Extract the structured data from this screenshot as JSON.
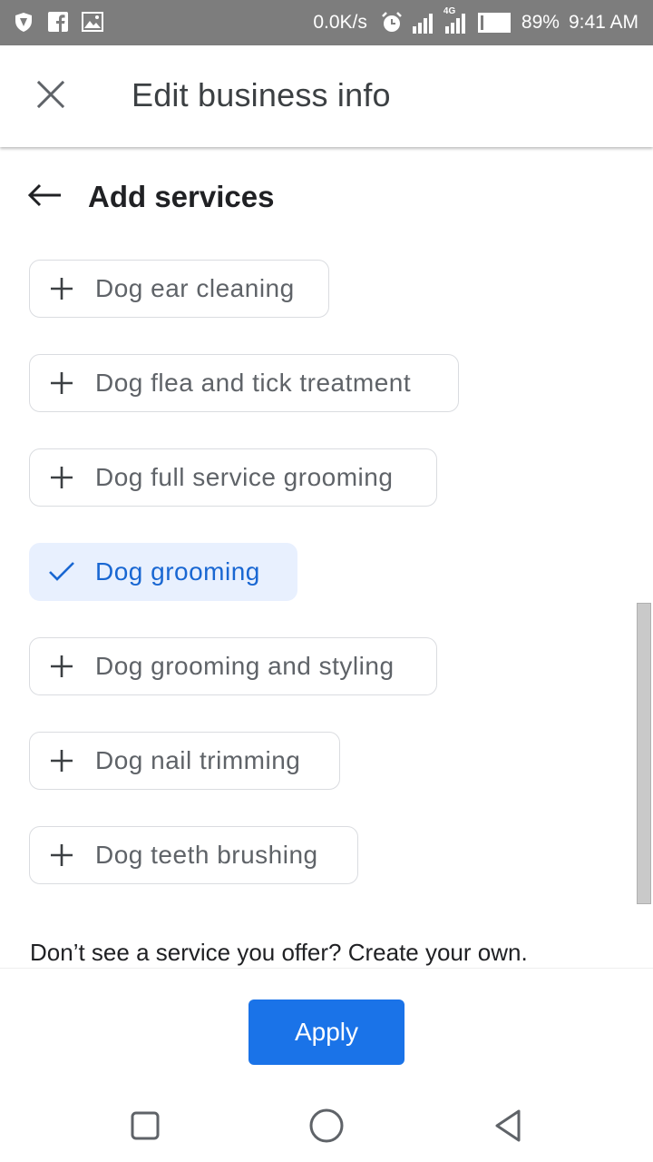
{
  "status_bar": {
    "network_speed": "0.0K/s",
    "network_type": "4G",
    "battery": "89%",
    "time": "9:41 AM",
    "left_icons": [
      "shield-icon",
      "facebook-icon",
      "image-icon"
    ],
    "right_icons": [
      "alarm-icon",
      "signal-icon",
      "signal-4g-icon",
      "battery-icon"
    ]
  },
  "header": {
    "title": "Edit business info",
    "close_icon": "close-icon"
  },
  "sub_header": {
    "title": "Add services",
    "back_icon": "arrow-back-icon"
  },
  "services": [
    {
      "label": "Dog ear cleaning",
      "selected": false,
      "icon": "plus-icon"
    },
    {
      "label": "Dog flea and tick treatment",
      "selected": false,
      "icon": "plus-icon"
    },
    {
      "label": "Dog full service grooming",
      "selected": false,
      "icon": "plus-icon"
    },
    {
      "label": "Dog grooming",
      "selected": true,
      "icon": "check-icon"
    },
    {
      "label": "Dog grooming and styling",
      "selected": false,
      "icon": "plus-icon"
    },
    {
      "label": "Dog nail trimming",
      "selected": false,
      "icon": "plus-icon"
    },
    {
      "label": "Dog teeth brushing",
      "selected": false,
      "icon": "plus-icon"
    }
  ],
  "helper_text": "Don’t see a service you offer? Create your own.",
  "apply_label": "Apply",
  "colors": {
    "primary": "#1a73e8",
    "selected_chip_bg": "#e8f0fe",
    "selected_chip_text": "#1967d2",
    "chip_text": "#5f6368",
    "status_bar_bg": "#7d7d7d"
  },
  "nav_bar": {
    "icons": [
      "recent-apps-icon",
      "home-icon",
      "back-nav-icon"
    ]
  }
}
